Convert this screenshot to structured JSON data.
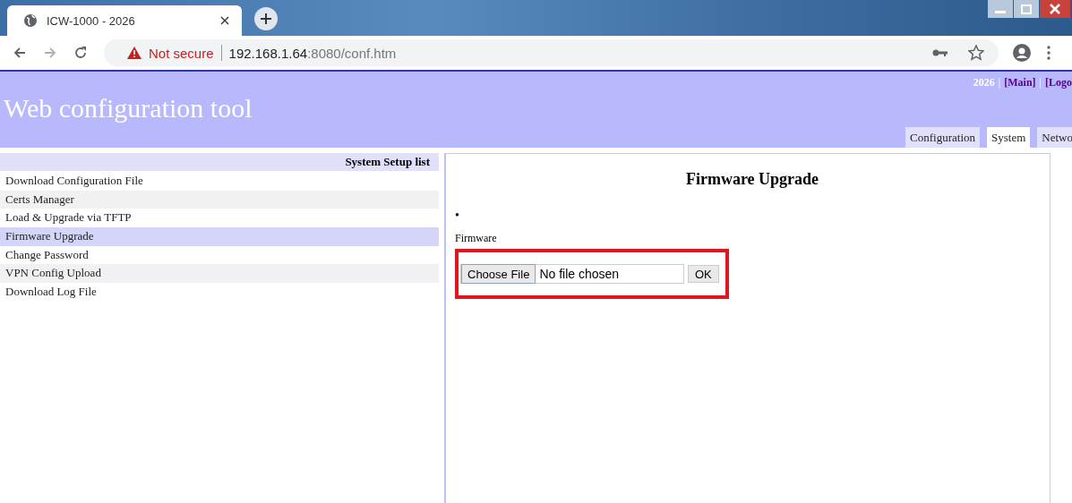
{
  "browser": {
    "tab_title": "ICW-1000 - 2026",
    "not_secure": "Not secure",
    "url_host": "192.168.1.64",
    "url_rest": ":8080/conf.htm"
  },
  "header": {
    "title": "Web configuration tool",
    "links": [
      {
        "text": "2026",
        "kind": "label"
      },
      {
        "text": "|",
        "kind": "sep"
      },
      {
        "text": "[Main]",
        "kind": "link"
      },
      {
        "text": "|",
        "kind": "sep"
      },
      {
        "text": "[Logo",
        "kind": "link"
      }
    ],
    "tabs": [
      {
        "label": "Configuration",
        "selected": false
      },
      {
        "label": "System",
        "selected": true
      },
      {
        "label": "Netwo",
        "selected": false
      }
    ]
  },
  "sidebar": {
    "heading": "System Setup list",
    "items": [
      {
        "label": "Download Configuration File",
        "selected": false
      },
      {
        "label": "Certs Manager",
        "selected": false
      },
      {
        "label": "Load & Upgrade via TFTP",
        "selected": false
      },
      {
        "label": "Firmware Upgrade",
        "selected": true
      },
      {
        "label": "Change Password",
        "selected": false
      },
      {
        "label": "VPN Config Upload",
        "selected": false
      },
      {
        "label": "Download Log File",
        "selected": false
      }
    ]
  },
  "content": {
    "title": "Firmware Upgrade",
    "bullet": "•",
    "field_label": "Firmware",
    "choose_button": "Choose File",
    "file_status": "No file chosen",
    "ok_button": "OK"
  }
}
